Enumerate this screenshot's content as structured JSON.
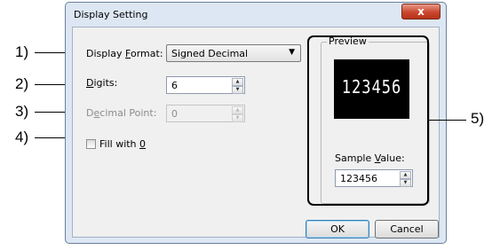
{
  "window": {
    "title": "Display Setting",
    "close_glyph": "x"
  },
  "callouts": [
    "1)",
    "2)",
    "3)",
    "4)",
    "5)"
  ],
  "form": {
    "display_format": {
      "label_pre": "Display ",
      "label_access": "F",
      "label_post": "ormat:",
      "value": "Signed Decimal"
    },
    "digits": {
      "label_access": "D",
      "label_post": "igits:",
      "value": "6"
    },
    "decimal_point": {
      "label_pre": "D",
      "label_access": "e",
      "label_post": "cimal Point:",
      "value": "0"
    },
    "fill": {
      "label_pre": "Fill with ",
      "label_access": "0",
      "checked": false
    }
  },
  "preview": {
    "group_label": "Preview",
    "display_value": "123456",
    "sample_label_pre": "Sample ",
    "sample_label_access": "V",
    "sample_label_post": "alue:",
    "sample_value": "123456"
  },
  "buttons": {
    "ok": "OK",
    "cancel": "Cancel"
  },
  "icons": {
    "dropdown": "chevron-down-icon",
    "spin_up": "spin-up-icon",
    "spin_down": "spin-down-icon",
    "close": "close-icon"
  }
}
